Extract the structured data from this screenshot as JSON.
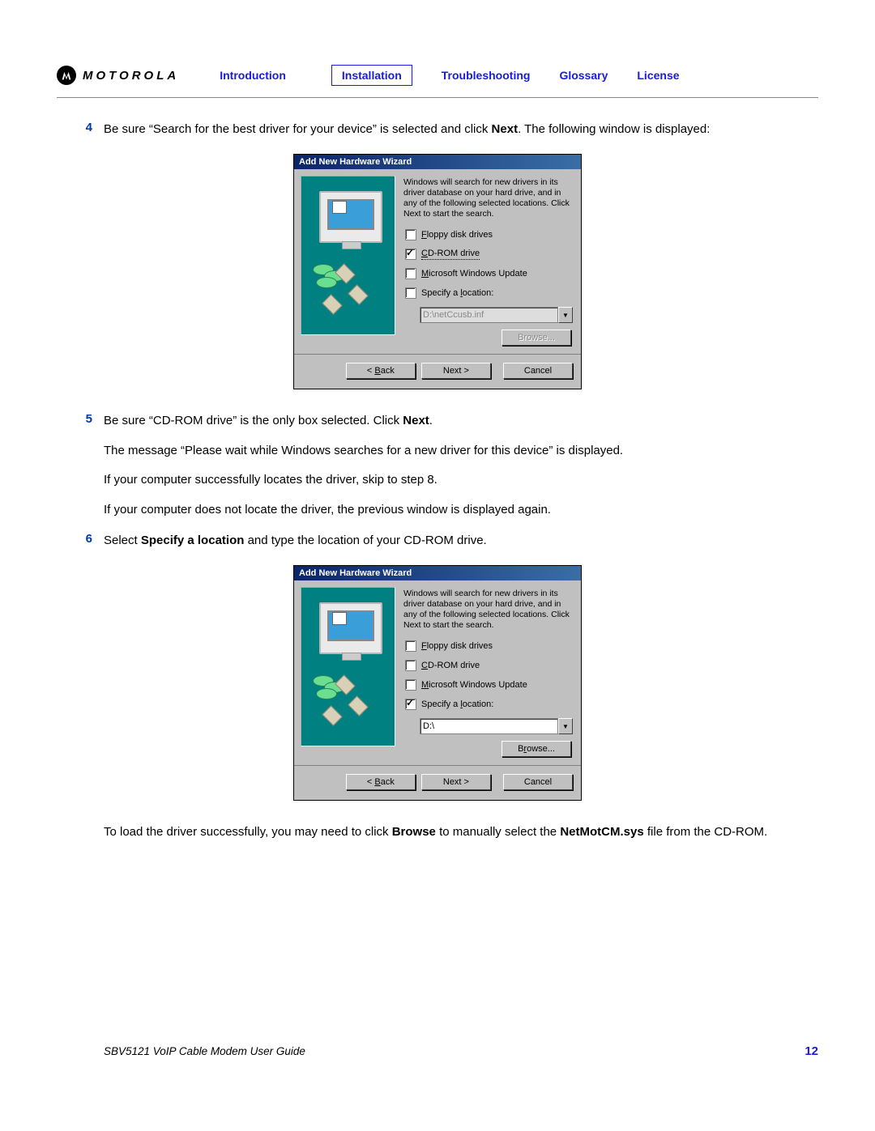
{
  "header": {
    "brand": "MOTOROLA",
    "nav": [
      "Introduction",
      "Installation",
      "Troubleshooting",
      "Glossary",
      "License"
    ]
  },
  "steps": [
    {
      "num": "4",
      "text_a": "Be sure “Search for the best driver for your device” is selected and click ",
      "bold_a": "Next",
      "text_b": ". The following window is displayed:"
    },
    {
      "num": "5",
      "lines": {
        "0": {
          "a": "Be sure “CD-ROM drive” is the only box selected. Click ",
          "b": "Next",
          "c": "."
        },
        "1": "The message “Please wait while Windows searches for a new driver for this device” is displayed.",
        "2": "If your computer successfully locates the driver, skip to step 8.",
        "3": "If your computer does not locate the driver, the previous window is displayed again."
      }
    },
    {
      "num": "6",
      "text_a": "Select ",
      "bold_a": "Specify a location",
      "text_b": " and type the location of your CD-ROM drive."
    }
  ],
  "wizard1": {
    "title": "Add New Hardware Wizard",
    "message": "Windows will search for new drivers in its driver database on your hard drive, and in any of the following selected locations. Click Next to start the search.",
    "opts": [
      {
        "u": "F",
        "t": "loppy disk drives"
      },
      {
        "u": "C",
        "t": "D-ROM drive"
      },
      {
        "u": "M",
        "t": "icrosoft Windows Update"
      },
      {
        "p": "Specify a ",
        "u": "l",
        "t": "ocation:"
      }
    ],
    "location": "D:\\netCcusb.inf",
    "browse": "Browse...",
    "buttons": {
      "back_u": "B",
      "back_t": "ack",
      "next": "Next",
      "cancel": "Cancel"
    }
  },
  "wizard2": {
    "title": "Add New Hardware Wizard",
    "message": "Windows will search for new drivers in its driver database on your hard drive, and in any of the following selected locations. Click Next to start the search.",
    "opts": [
      {
        "u": "F",
        "t": "loppy disk drives"
      },
      {
        "u": "C",
        "t": "D-ROM drive"
      },
      {
        "u": "M",
        "t": "icrosoft Windows Update"
      },
      {
        "p": "Specify a ",
        "u": "l",
        "t": "ocation:"
      }
    ],
    "location": "D:\\",
    "browse_pre": "B",
    "browse_u": "r",
    "browse_post": "owse...",
    "buttons": {
      "back_u": "B",
      "back_t": "ack",
      "next": "Next",
      "cancel": "Cancel"
    }
  },
  "trailing": {
    "a": "To load the driver successfully, you may need to click ",
    "b1": "Browse",
    "c": " to manually select the ",
    "b2": "NetMotCM.sys",
    "d": " file from the CD-ROM."
  },
  "footer": {
    "guide": "SBV5121 VoIP Cable Modem User Guide",
    "page": "12"
  }
}
